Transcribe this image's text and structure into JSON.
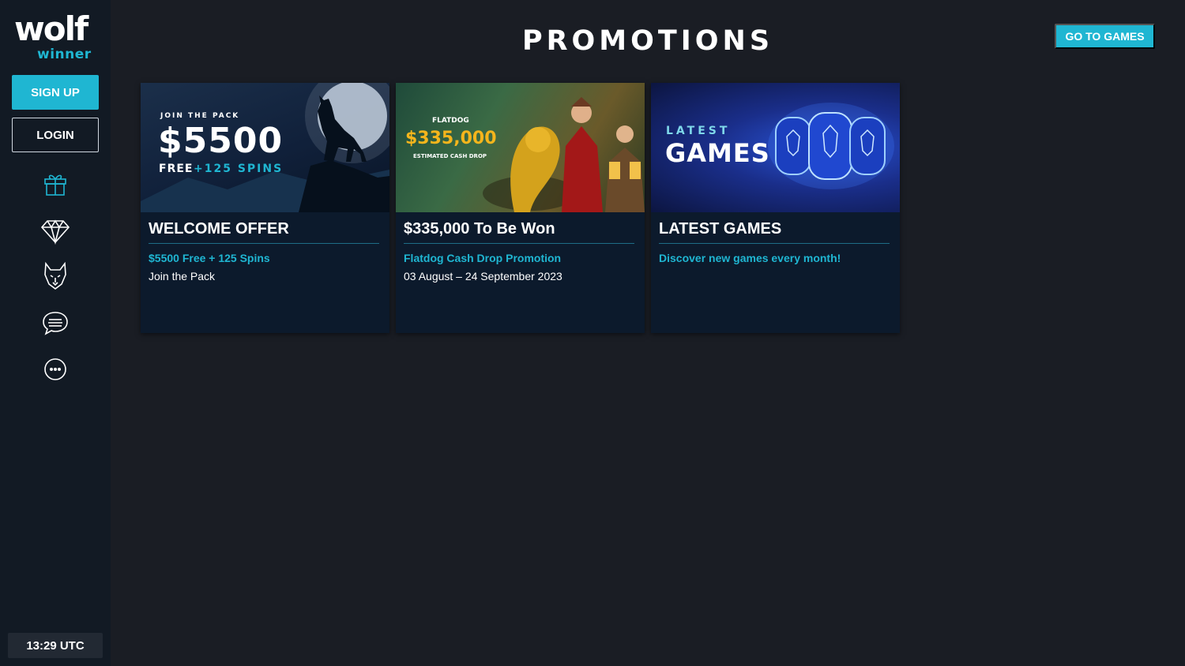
{
  "brand": {
    "logo_word": "wolf",
    "logo_sub": "winner"
  },
  "sidebar": {
    "signup_label": "SIGN UP",
    "login_label": "LOGIN",
    "nav_icons": [
      "gift-icon",
      "diamond-icon",
      "wolf-icon",
      "chat-icon",
      "more-icon"
    ],
    "clock": "13:29 UTC"
  },
  "header": {
    "title": "PROMOTIONS",
    "go_to_games_label": "GO TO GAMES"
  },
  "colors": {
    "accent": "#1fb6d2",
    "background": "#1a1d24",
    "sidebar": "#121a24",
    "card": "#0c1a2c"
  },
  "cards": [
    {
      "title": "WELCOME OFFER",
      "subtitle": "$5500 Free + 125 Spins",
      "description": "Join the Pack",
      "banner": {
        "kicker": "JOIN THE PACK",
        "amount": "$5500",
        "free": "FREE",
        "spins": "+125 SPINS"
      }
    },
    {
      "title": "$335,000 To Be Won",
      "subtitle": "Flatdog Cash Drop Promotion",
      "description": "03 August – 24 September 2023",
      "banner": {
        "brand": "FLATDOG",
        "amount": "$335,000",
        "caption": "ESTIMATED CASH DROP"
      }
    },
    {
      "title": "LATEST GAMES",
      "subtitle": "Discover new games every month!",
      "description": "",
      "banner": {
        "kicker": "LATEST",
        "headline": "GAMES"
      }
    }
  ]
}
